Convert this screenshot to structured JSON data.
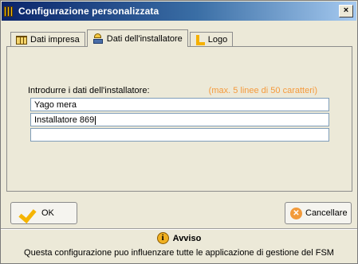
{
  "window": {
    "title": "Configurazione personalizzata",
    "close_glyph": "×"
  },
  "tabs": [
    {
      "label": "Dati impresa",
      "icon": "grid-icon"
    },
    {
      "label": "Dati dell'installatore",
      "icon": "installer-icon"
    },
    {
      "label": "Logo",
      "icon": "logo-icon"
    }
  ],
  "form": {
    "label": "Introdurre i dati dell'installatore:",
    "hint": "(max. 5 linee di 50 caratteri)",
    "lines": [
      "Yago mera",
      "Installatore 869",
      ""
    ]
  },
  "buttons": {
    "ok": "OK",
    "cancel": "Cancellare"
  },
  "notice": {
    "title": "Avviso",
    "text": "Questa configurazione puo influenzare tutte le applicazione di gestione del FSM"
  },
  "colors": {
    "hint": "#f59a3c",
    "titlebar": "#0a246a",
    "accent": "#f5b400"
  }
}
